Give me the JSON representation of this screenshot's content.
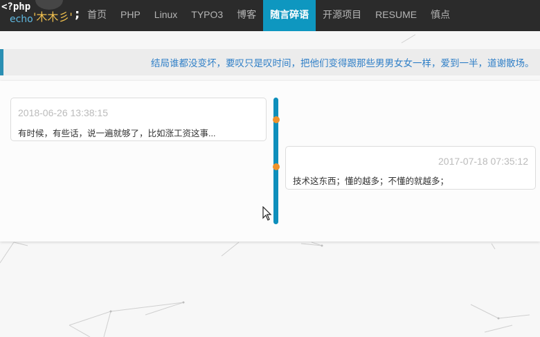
{
  "logo": {
    "php": "<?php",
    "echo": "echo",
    "name": "'木木彡'",
    "semicolon": ";"
  },
  "nav": {
    "items": [
      "首页",
      "PHP",
      "Linux",
      "TYPO3",
      "博客",
      "随言碎语",
      "开源项目",
      "RESUME",
      "慎点"
    ],
    "active": "随言碎语"
  },
  "notice": {
    "text": "结局谁都没变坏，要叹只是叹时间，把他们变得跟那些男男女女一样，爱到一半，道谢散场。"
  },
  "timeline": {
    "entries": [
      {
        "time": "2018-06-26 13:38:15",
        "text": "有时候，有些话，说一遍就够了，比如涨工资这事..."
      },
      {
        "time": "2017-07-18 07:35:12",
        "text": "技术这东西；懂的越多；不懂的就越多；"
      }
    ]
  },
  "colors": {
    "navbar": "#2b2b2b",
    "accent": "#0e97c0",
    "dot": "#f0922b",
    "notice_text": "#2f7fc7"
  }
}
